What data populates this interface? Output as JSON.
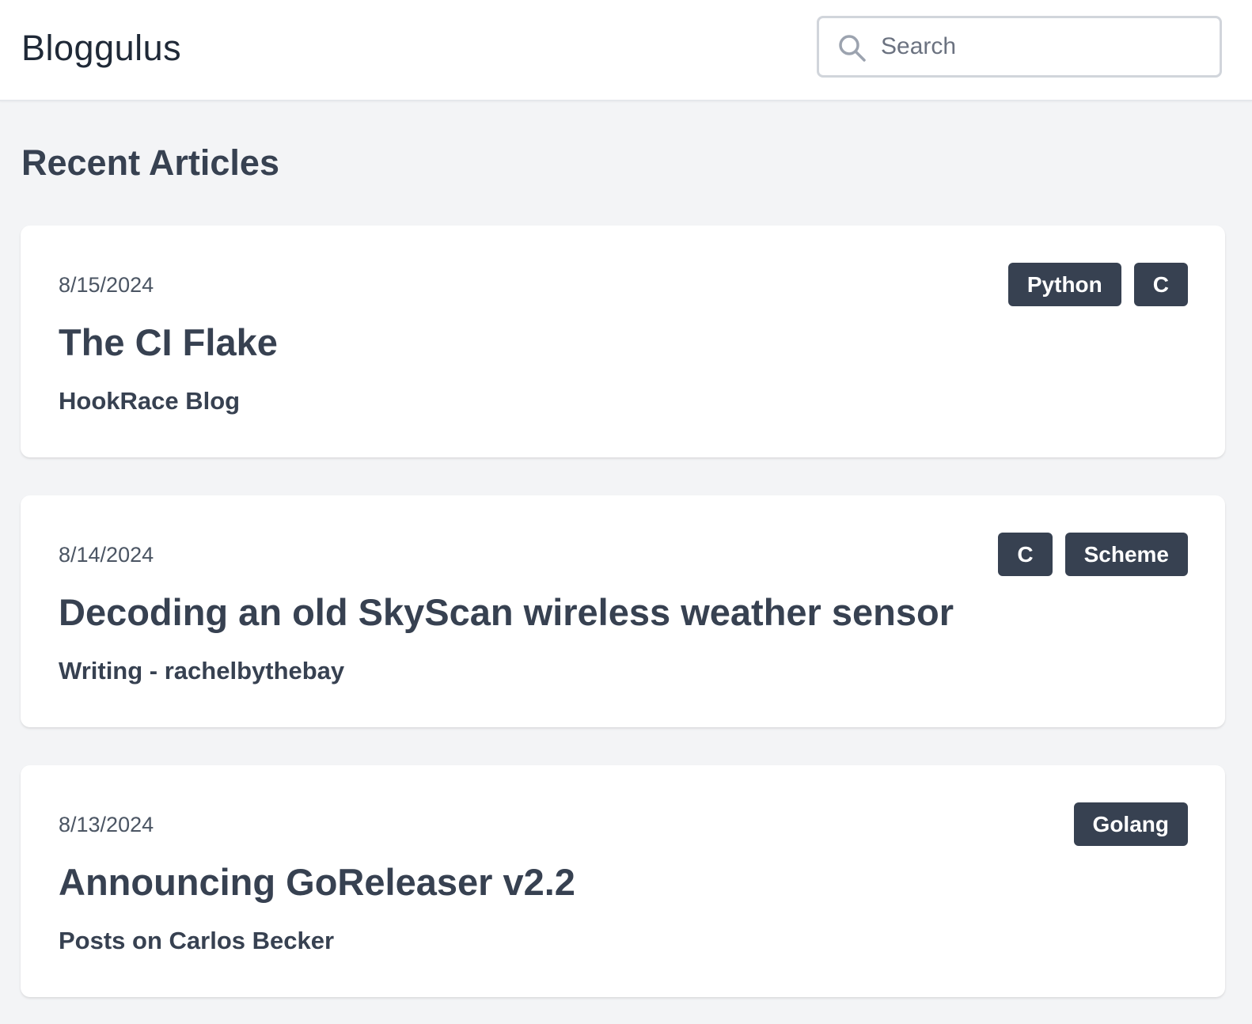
{
  "header": {
    "brand": "Bloggulus",
    "search_placeholder": "Search",
    "search_value": ""
  },
  "main": {
    "section_title": "Recent Articles",
    "articles": [
      {
        "date": "8/15/2024",
        "title": "The CI Flake",
        "source": "HookRace Blog",
        "tags": [
          "Python",
          "C"
        ]
      },
      {
        "date": "8/14/2024",
        "title": "Decoding an old SkyScan wireless weather sensor",
        "source": "Writing - rachelbythebay",
        "tags": [
          "C",
          "Scheme"
        ]
      },
      {
        "date": "8/13/2024",
        "title": "Announcing GoReleaser v2.2",
        "source": "Posts on Carlos Becker",
        "tags": [
          "Golang"
        ]
      }
    ]
  },
  "icons": {
    "search": "search-icon"
  },
  "colors": {
    "page_background": "#f3f4f6",
    "card_background": "#ffffff",
    "text_primary": "#374151",
    "tag_background": "#374151",
    "tag_text": "#ffffff",
    "input_border": "#d1d5db"
  }
}
